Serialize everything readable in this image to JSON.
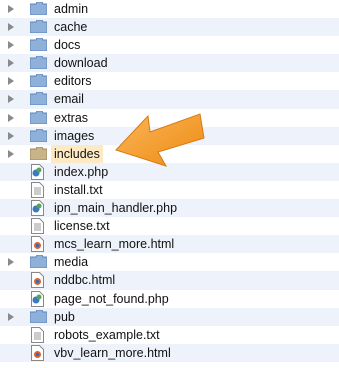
{
  "items": [
    {
      "name": "admin",
      "kind": "folder"
    },
    {
      "name": "cache",
      "kind": "folder"
    },
    {
      "name": "docs",
      "kind": "folder"
    },
    {
      "name": "download",
      "kind": "folder"
    },
    {
      "name": "editors",
      "kind": "folder"
    },
    {
      "name": "email",
      "kind": "folder"
    },
    {
      "name": "extras",
      "kind": "folder"
    },
    {
      "name": "images",
      "kind": "folder"
    },
    {
      "name": "includes",
      "kind": "folder",
      "highlighted": true
    },
    {
      "name": "index.php",
      "kind": "php"
    },
    {
      "name": "install.txt",
      "kind": "txt"
    },
    {
      "name": "ipn_main_handler.php",
      "kind": "php"
    },
    {
      "name": "license.txt",
      "kind": "txt"
    },
    {
      "name": "mcs_learn_more.html",
      "kind": "html"
    },
    {
      "name": "media",
      "kind": "folder"
    },
    {
      "name": "nddbc.html",
      "kind": "html"
    },
    {
      "name": "page_not_found.php",
      "kind": "php"
    },
    {
      "name": "pub",
      "kind": "folder"
    },
    {
      "name": "robots_example.txt",
      "kind": "txt"
    },
    {
      "name": "vbv_learn_more.html",
      "kind": "html"
    }
  ],
  "colors": {
    "highlight": "#fde9c4",
    "arrow": "#f39c1f",
    "folder": "#8fb0d8",
    "alt_row": "#eef3fb"
  }
}
